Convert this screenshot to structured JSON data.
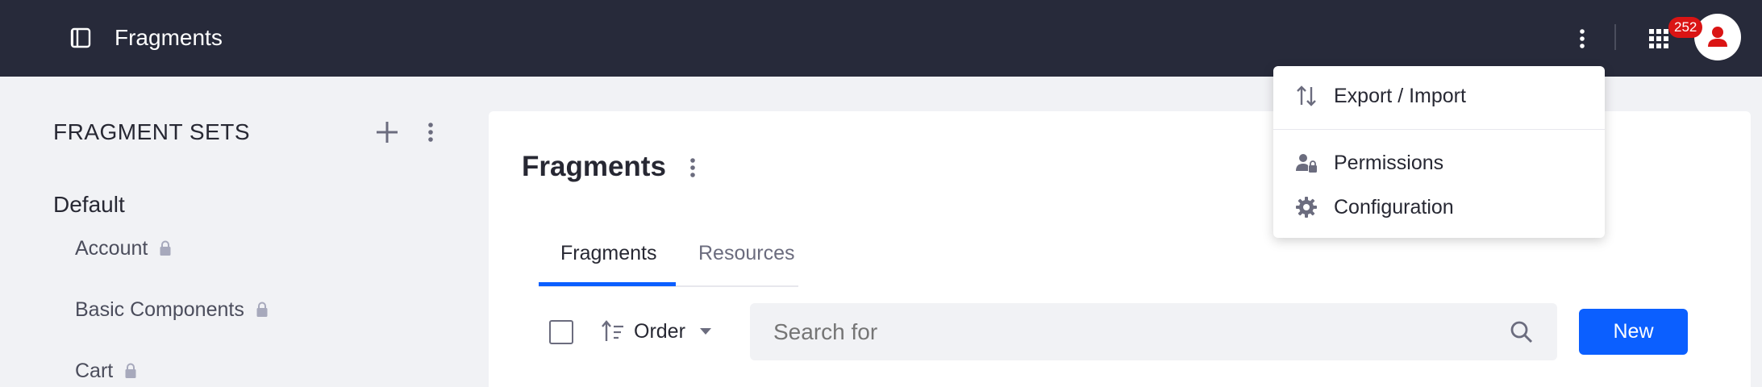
{
  "header": {
    "title": "Fragments",
    "notification_count": "252",
    "icons": [
      "sidebar-toggle-icon",
      "more-vertical-icon",
      "apps-grid-icon",
      "user-icon"
    ]
  },
  "sidebar": {
    "heading": "FRAGMENT SETS",
    "group_label": "Default",
    "items": [
      {
        "label": "Account",
        "locked": true
      },
      {
        "label": "Basic Components",
        "locked": true
      },
      {
        "label": "Cart",
        "locked": true
      }
    ]
  },
  "main": {
    "title": "Fragments",
    "tabs": [
      {
        "label": "Fragments",
        "active": true
      },
      {
        "label": "Resources",
        "active": false
      }
    ],
    "toolbar": {
      "order_label": "Order",
      "search_placeholder": "Search for",
      "new_label": "New"
    }
  },
  "dropdown": {
    "items": [
      {
        "label": "Export / Import",
        "icon": "import-export-icon"
      },
      {
        "label": "Permissions",
        "icon": "permissions-icon"
      },
      {
        "label": "Configuration",
        "icon": "gear-icon"
      }
    ]
  },
  "colors": {
    "topbar": "#272a3a",
    "accent": "#0b5fff",
    "badge": "#da1414",
    "avatar_icon": "#da1414",
    "page_bg": "#f1f2f5"
  }
}
